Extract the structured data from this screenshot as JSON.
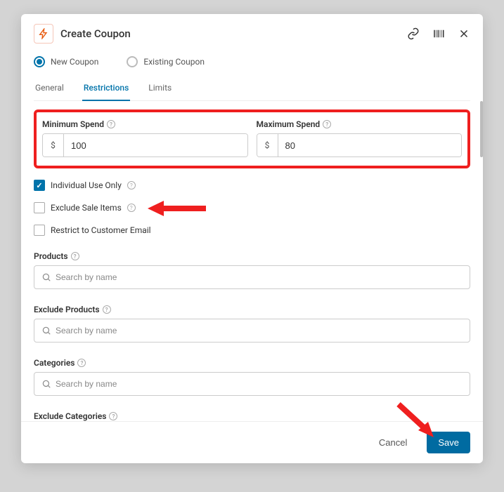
{
  "header": {
    "title": "Create Coupon"
  },
  "couponType": {
    "new_label": "New Coupon",
    "existing_label": "Existing Coupon"
  },
  "tabs": {
    "general": "General",
    "restrictions": "Restrictions",
    "limits": "Limits"
  },
  "spend": {
    "min_label": "Minimum Spend",
    "max_label": "Maximum Spend",
    "currency": "$",
    "min_value": "100",
    "max_value": "80"
  },
  "checks": {
    "individual_use": "Individual Use Only",
    "exclude_sale": "Exclude Sale Items",
    "restrict_email": "Restrict to Customer Email"
  },
  "sections": {
    "products": "Products",
    "exclude_products": "Exclude Products",
    "categories": "Categories",
    "exclude_categories": "Exclude Categories",
    "search_placeholder": "Search by name"
  },
  "footer": {
    "cancel": "Cancel",
    "save": "Save"
  }
}
